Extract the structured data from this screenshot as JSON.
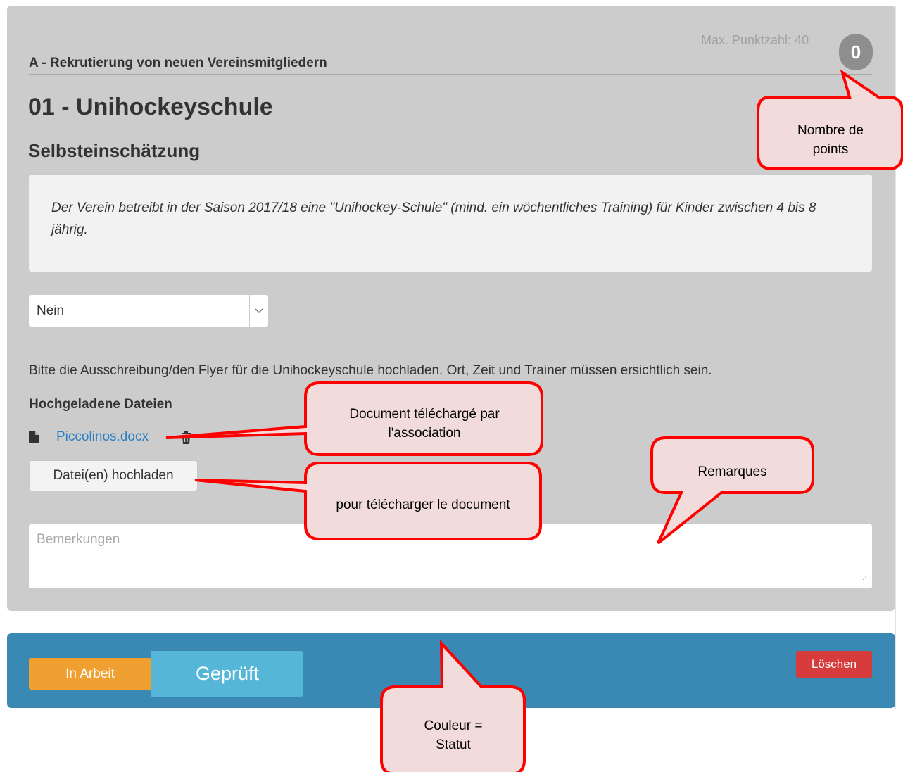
{
  "header": {
    "section_label": "A - Rekrutierung von neuen Vereinsmitgliedern",
    "max_points_label": "Max. Punktzahl: 40",
    "points": "0"
  },
  "item": {
    "title": "01 - Unihockeyschule",
    "subtitle": "Selbsteinschätzung",
    "description": "Der Verein betreibt in der Saison 2017/18 eine \"Unihockey-Schule\" (mind. ein wöchentliches Training) für Kinder zwischen 4 bis 8 jährig."
  },
  "answer_select": {
    "selected": "Nein"
  },
  "upload": {
    "hint": "Bitte die Ausschreibung/den Flyer für die Unihockeyschule hochladen. Ort, Zeit und Trainer müssen ersichtlich sein.",
    "files_label": "Hochgeladene Dateien",
    "files": [
      {
        "name": "Piccolinos.docx",
        "icon": "file-icon"
      }
    ],
    "delete_icon": "trash-icon",
    "button_label": "Datei(en) hochladen"
  },
  "remarks": {
    "placeholder": "Bemerkungen"
  },
  "status": {
    "in_arbeit_label": "In Arbeit",
    "geprueft_label": "Geprüft",
    "loeschen_label": "Löschen",
    "colors": {
      "in_arbeit": "#f0a030",
      "geprueft": "#55b6d8",
      "loeschen": "#d63c3c",
      "bar": "#3a88b4"
    }
  },
  "annotations": {
    "points": [
      "Nombre de",
      "points"
    ],
    "document": [
      "Document téléchargé par",
      "l'association"
    ],
    "upload": "pour télécharger le document",
    "remarks": "Remarques",
    "status": [
      "Couleur =",
      "Statut"
    ]
  }
}
